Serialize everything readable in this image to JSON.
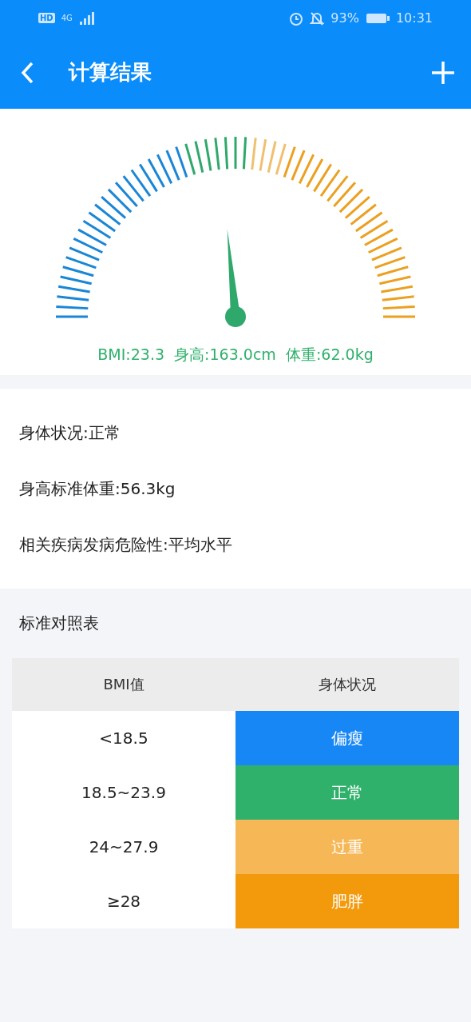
{
  "status_bar": {
    "hd": "HD",
    "network": "4G",
    "battery": "93%",
    "time": "10:31"
  },
  "toolbar": {
    "title": "计算结果"
  },
  "gauge": {
    "summary": "BMI:23.3  身高:163.0cm  体重:62.0kg"
  },
  "details": [
    "身体状况:正常",
    "身高标准体重:56.3kg",
    "相关疾病发病危险性:平均水平"
  ],
  "reference": {
    "title": "标准对照表",
    "columns": [
      "BMI值",
      "身体状况"
    ],
    "rows": [
      {
        "range": "<18.5",
        "status": "偏瘦",
        "color": "#1787f5"
      },
      {
        "range": "18.5~23.9",
        "status": "正常",
        "color": "#2fb06b"
      },
      {
        "range": "24~27.9",
        "status": "过重",
        "color": "#f6b756"
      },
      {
        "range": "≥28",
        "status": "肥胖",
        "color": "#f29a0c"
      }
    ]
  }
}
